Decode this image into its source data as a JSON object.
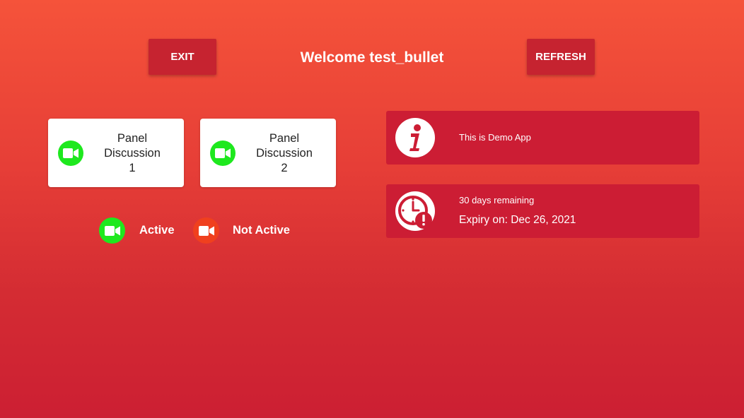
{
  "header": {
    "exit_label": "EXIT",
    "welcome": "Welcome test_bullet",
    "refresh_label": "REFRESH"
  },
  "rooms": [
    {
      "line1": "Panel",
      "line2": "Discussion",
      "line3": "1",
      "status": "active"
    },
    {
      "line1": "Panel",
      "line2": "Discussion",
      "line3": "2",
      "status": "active"
    }
  ],
  "legend": {
    "active_label": "Active",
    "inactive_label": "Not Active"
  },
  "info": {
    "demo_text": "This is Demo App",
    "days_remaining": "30 days remaining",
    "expiry": "Expiry on: Dec 26, 2021"
  },
  "colors": {
    "active": "#1ee81e",
    "inactive": "#f0401e",
    "card_bg": "#cc1d34"
  },
  "icons": {
    "room_status": "video-camera-icon",
    "info": "info-icon",
    "expiry": "clock-alert-icon"
  }
}
